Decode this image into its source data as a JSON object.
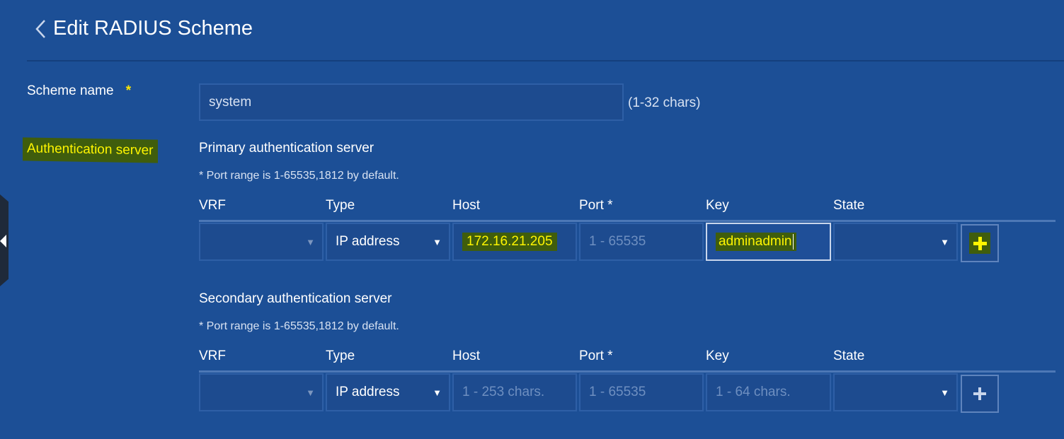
{
  "header": {
    "title": "Edit RADIUS Scheme"
  },
  "scheme": {
    "label": "Scheme name",
    "required_mark": "*",
    "value": "system",
    "hint": "(1-32 chars)"
  },
  "auth": {
    "label": "Authentication server"
  },
  "columns": [
    "VRF",
    "Type",
    "Host",
    "Port *",
    "Key",
    "State"
  ],
  "primary": {
    "title": "Primary authentication server",
    "note": "* Port range is 1-65535,1812 by default.",
    "vrf": "",
    "type": "IP address",
    "host": "172.16.21.205",
    "port_placeholder": "1 - 65535",
    "key": "adminadmin",
    "state": ""
  },
  "secondary": {
    "title": "Secondary authentication server",
    "note": "* Port range is 1-65535,1812 by default.",
    "vrf": "",
    "type": "IP address",
    "host_placeholder": "1 - 253 chars.",
    "port_placeholder": "1 - 65535",
    "key_placeholder": "1 - 64 chars.",
    "state": ""
  },
  "colors": {
    "background": "#1c4f96",
    "highlight_bg": "#3f5d0d",
    "highlight_text": "#fff500"
  },
  "icons": [
    "chevron-left-icon",
    "caret-down-icon",
    "plus-icon",
    "collapse-arrow-icon"
  ]
}
